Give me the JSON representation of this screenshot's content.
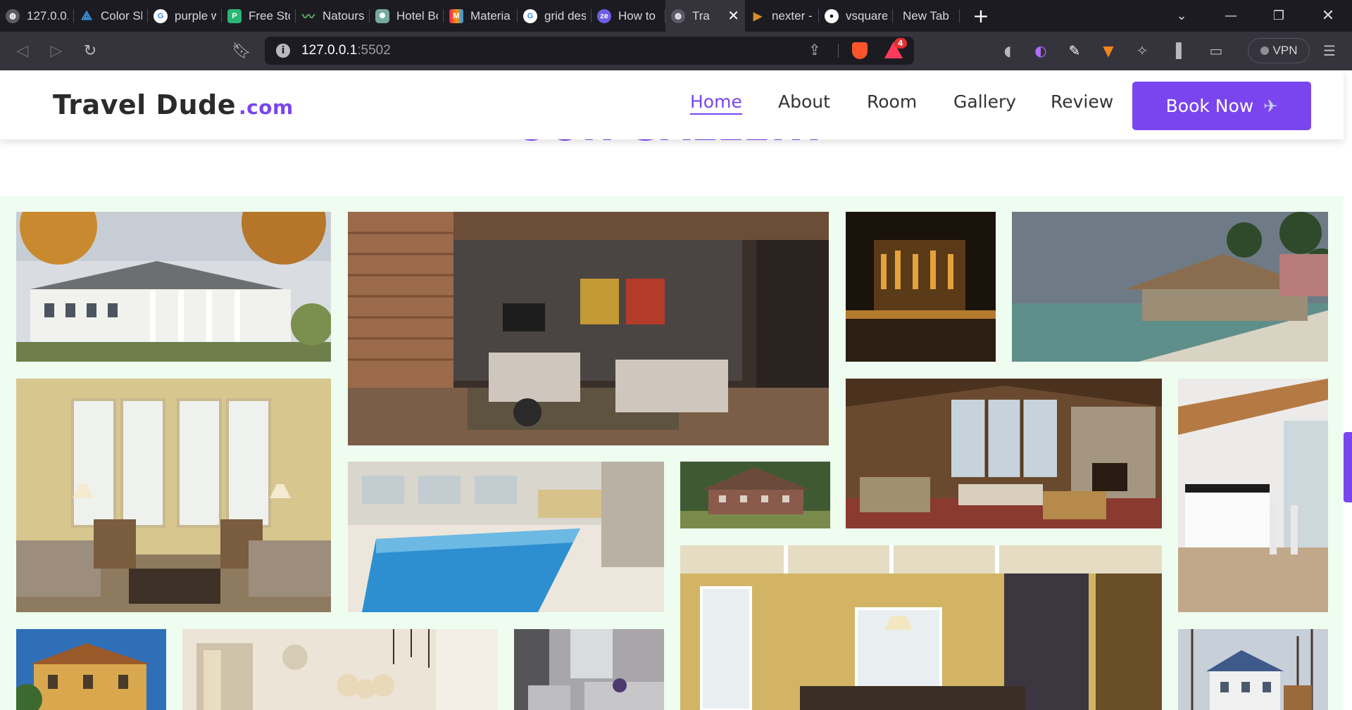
{
  "browser": {
    "tabs": [
      {
        "title": "127.0.0.",
        "favicon": "globe-icon",
        "color": "#5b5b66"
      },
      {
        "title": "Color Sh",
        "favicon": "color-shades-icon",
        "color": "#3d9be9"
      },
      {
        "title": "purple w",
        "favicon": "google-icon",
        "color": "#ffffff"
      },
      {
        "title": "Free Sto",
        "favicon": "stock-icon",
        "color": "#2bb673"
      },
      {
        "title": "Natours",
        "favicon": "natours-icon",
        "color": "#5cb85c"
      },
      {
        "title": "Hotel Bo",
        "favicon": "chatgpt-icon",
        "color": "#74aa9c"
      },
      {
        "title": "Materia",
        "favicon": "material-icon",
        "color": "#e91e63"
      },
      {
        "title": "grid des",
        "favicon": "google-icon",
        "color": "#ffffff"
      },
      {
        "title": "How to",
        "favicon": "ze-icon",
        "color": "#6f5de8"
      },
      {
        "title": "Tra",
        "favicon": "globe-icon",
        "color": "#5b5b66",
        "active": true
      },
      {
        "title": "nexter -",
        "favicon": "play-icon",
        "color": "#d98c2b"
      },
      {
        "title": "vsquare",
        "favicon": "github-icon",
        "color": "#ffffff"
      },
      {
        "title": "New Tab",
        "favicon": "",
        "color": ""
      }
    ],
    "new_tab_glyph": "+",
    "url_host": "127.0.0.1",
    "url_port": ":5502",
    "rewards_badge": "4",
    "vpn_label": "VPN"
  },
  "site": {
    "logo_main": "Travel Dude",
    "logo_domain": ".com",
    "nav": [
      {
        "label": "Home",
        "active": true
      },
      {
        "label": "About",
        "active": false
      },
      {
        "label": "Room",
        "active": false
      },
      {
        "label": "Gallery",
        "active": false
      },
      {
        "label": "Review",
        "active": false
      }
    ],
    "cta_label": "Book Now",
    "section_title": "OUR GALLERY",
    "accent_color": "#7a45ef",
    "gallery_bg": "#eefdf0"
  },
  "gallery": [
    {
      "subject": "autumn-mansion-photo"
    },
    {
      "subject": "living-room-photo"
    },
    {
      "subject": "hotel-bar-photo"
    },
    {
      "subject": "beach-resort-photo"
    },
    {
      "subject": "sunroom-photo"
    },
    {
      "subject": "indoor-pool-photo"
    },
    {
      "subject": "countryside-house-photo"
    },
    {
      "subject": "lodge-living-room-photo"
    },
    {
      "subject": "modern-kitchen-photo"
    },
    {
      "subject": "billiard-room-photo"
    },
    {
      "subject": "villa-exterior-photo"
    },
    {
      "subject": "bedroom-photo"
    },
    {
      "subject": "lounge-photo"
    },
    {
      "subject": "winter-house-photo"
    }
  ]
}
